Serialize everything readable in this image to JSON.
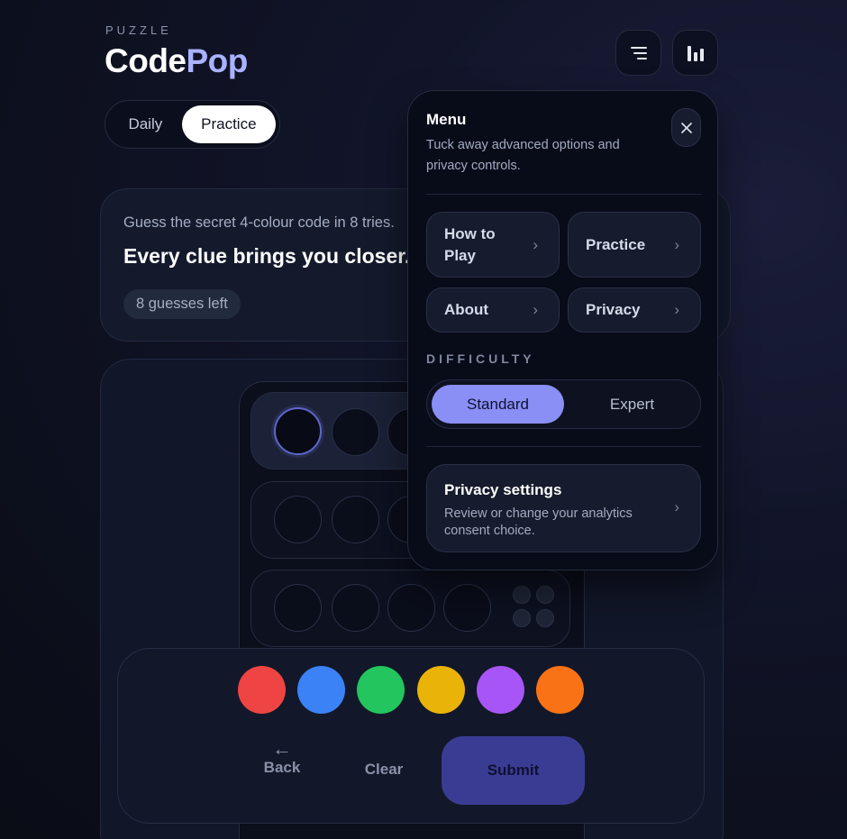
{
  "header": {
    "eyebrow": "PUZZLE",
    "brand_part1": "Code",
    "brand_part2": "Pop"
  },
  "mode_toggle": {
    "daily": "Daily",
    "practice": "Practice",
    "selected": "Practice"
  },
  "hero": {
    "intro": "Guess the secret 4-colour code in 8 tries.",
    "tagline": "Every clue brings you closer.",
    "guesses_left": "8 guesses left"
  },
  "palette": [
    {
      "name": "red",
      "color": "#ef4444"
    },
    {
      "name": "blue",
      "color": "#3b82f6"
    },
    {
      "name": "green",
      "color": "#22c55e"
    },
    {
      "name": "yellow",
      "color": "#eab308"
    },
    {
      "name": "purple",
      "color": "#a855f7"
    },
    {
      "name": "orange",
      "color": "#f97316"
    }
  ],
  "actions": {
    "back_arrow": "←",
    "back": "Back",
    "clear": "Clear",
    "submit": "Submit"
  },
  "menu": {
    "title": "Menu",
    "description": "Tuck away advanced options and privacy controls.",
    "close_glyph": "✕",
    "items": [
      {
        "label": "How to Play",
        "chevron": "›"
      },
      {
        "label": "Practice",
        "chevron": "›"
      },
      {
        "label": "About",
        "chevron": "›"
      },
      {
        "label": "Privacy",
        "chevron": "›"
      }
    ],
    "difficulty_label": "DIFFICULTY",
    "difficulty": {
      "standard": "Standard",
      "expert": "Expert",
      "selected": "Standard"
    },
    "privacy_card": {
      "title": "Privacy settings",
      "description": "Review or change your analytics consent choice.",
      "chevron": "›"
    }
  },
  "icons": {
    "menu_button": "lines-icon",
    "stats_button": "bar-chart-icon",
    "close": "close-icon"
  }
}
